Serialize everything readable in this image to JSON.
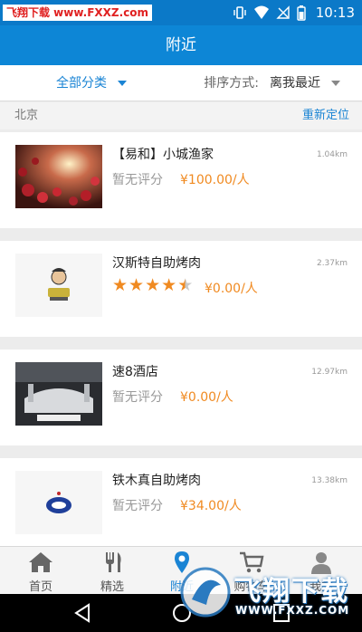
{
  "status_bar": {
    "watermark": "飞翔下载 www.FXXZ.com",
    "time": "10:13"
  },
  "header": {
    "title": "附近"
  },
  "filter": {
    "category": "全部分类",
    "sort_label": "排序方式:",
    "sort_value": "离我最近"
  },
  "location": {
    "city": "北京",
    "relocate": "重新定位"
  },
  "shops": [
    {
      "name": "【易和】小城渔家",
      "distance": "1.04km",
      "rating_text": "暂无评分",
      "price": "¥100.00/人"
    },
    {
      "name": "汉斯特自助烤肉",
      "distance": "2.37km",
      "rating_stars": 4.5,
      "price": "¥0.00/人"
    },
    {
      "name": "速8酒店",
      "distance": "12.97km",
      "rating_text": "暂无评分",
      "price": "¥0.00/人"
    },
    {
      "name": "铁木真自助烤肉",
      "distance": "13.38km",
      "rating_text": "暂无评分",
      "price": "¥34.00/人"
    }
  ],
  "tabs": [
    {
      "label": "首页",
      "icon": "home-icon"
    },
    {
      "label": "精选",
      "icon": "featured-icon"
    },
    {
      "label": "附近",
      "icon": "location-pin-icon",
      "active": true
    },
    {
      "label": "购物车",
      "icon": "cart-icon"
    },
    {
      "label": "我的",
      "icon": "user-icon"
    }
  ],
  "watermark": {
    "text": "飞翔下载",
    "url": "WWW.FXXZ.COM"
  },
  "colors": {
    "primary": "#0d86d6",
    "accent": "#f08a21",
    "link": "#1a84d4"
  }
}
